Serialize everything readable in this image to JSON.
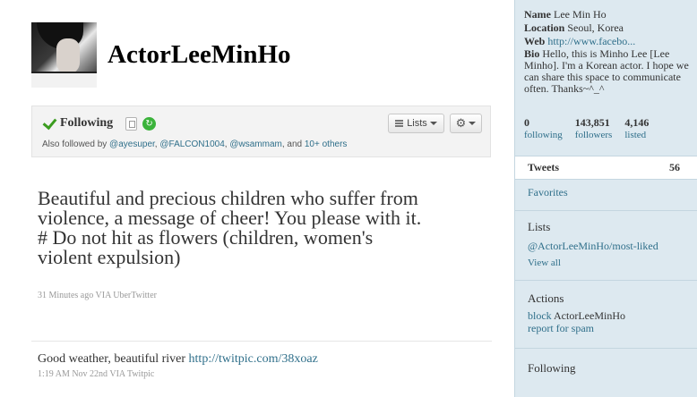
{
  "profile": {
    "screen_name": "ActorLeeMinHo"
  },
  "follow_box": {
    "following_label": "Following",
    "lists_label": "Lists",
    "also_followed_prefix": "Also followed by",
    "also_followed_users": [
      "@ayesuper",
      "@FALCON1004",
      "@wsammam"
    ],
    "also_followed_and": ", and",
    "also_followed_more": "10+ others"
  },
  "tweets": [
    {
      "text": "Beautiful and precious children who suffer from violence, a message of cheer! You please with it. # Do not hit as flowers (children, women's violent expulsion)",
      "meta": "31 Minutes ago VIA UberTwitter"
    },
    {
      "text": "Good weather, beautiful river",
      "link": "http://twitpic.com/38xoaz",
      "meta": "1:19 AM Nov 22nd VIA Twitpic"
    }
  ],
  "sidebar": {
    "name_label": "Name",
    "name_value": "Lee Min Ho",
    "location_label": "Location",
    "location_value": "Seoul, Korea",
    "web_label": "Web",
    "web_value": "http://www.facebo...",
    "bio_label": "Bio",
    "bio_value": "Hello, this is Minho Lee [Lee Minho]. I'm a Korean actor. I hope we can share this space to communicate often. Thanks~^_^",
    "stats": [
      {
        "num": "0",
        "label": "following"
      },
      {
        "num": "143,851",
        "label": "followers"
      },
      {
        "num": "4,146",
        "label": "listed"
      }
    ],
    "tweets_label": "Tweets",
    "tweets_count": "56",
    "favorites_label": "Favorites",
    "lists_heading": "Lists",
    "list_link": "@ActorLeeMinHo/most-liked",
    "view_all": "View all",
    "actions_heading": "Actions",
    "block_label": "block",
    "block_target": "ActorLeeMinHo",
    "report_label": "report for spam",
    "following_heading": "Following"
  }
}
